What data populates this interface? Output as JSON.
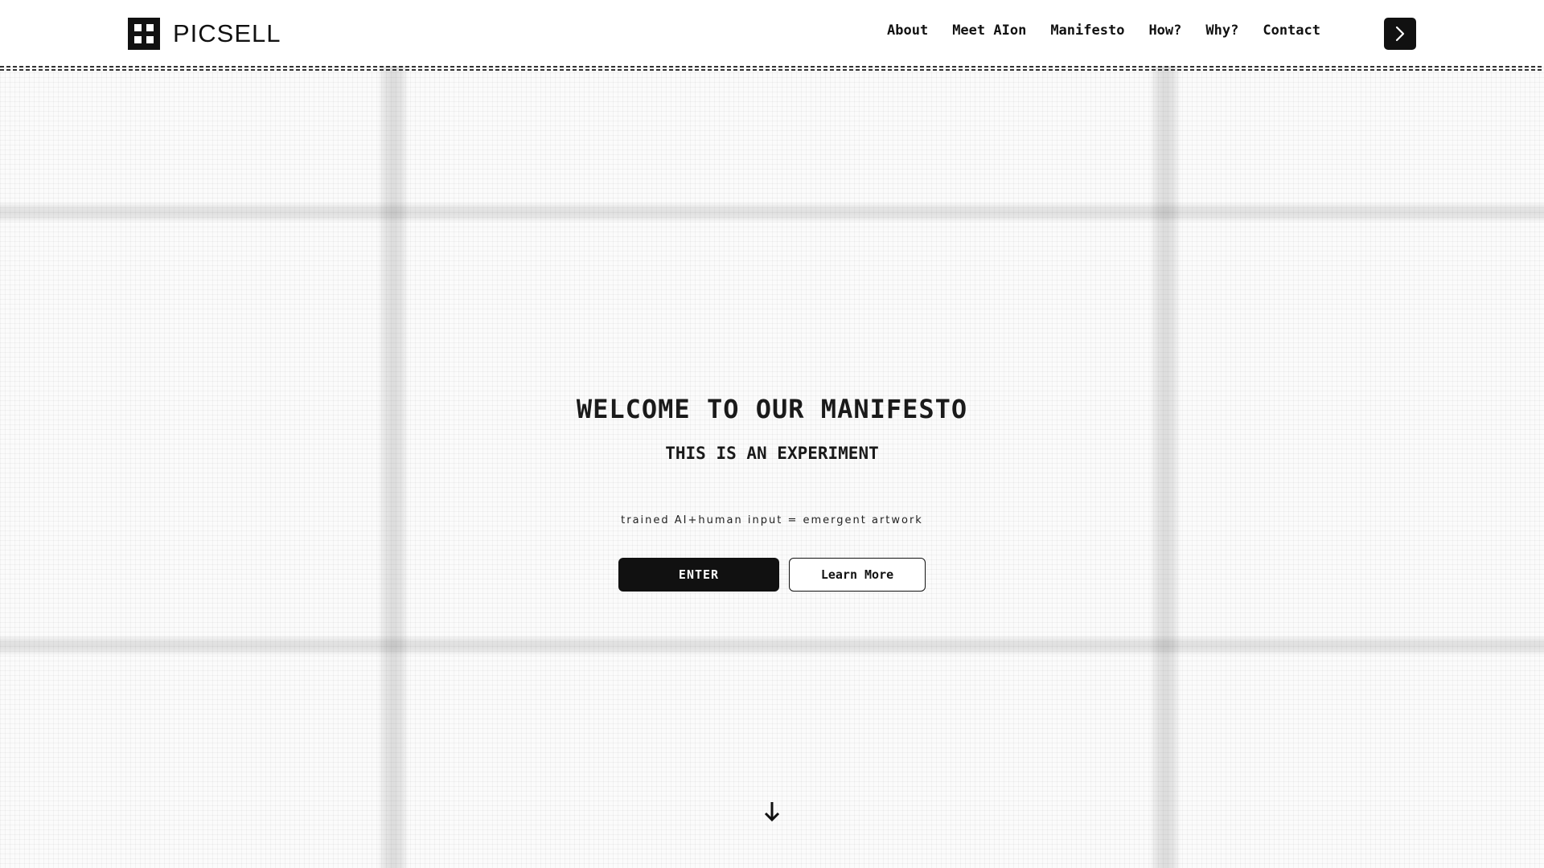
{
  "header": {
    "logo_text": "PICSELL",
    "nav": {
      "about": "About",
      "meet": "Meet AIon",
      "manifesto": "Manifesto",
      "how": "How?",
      "why": "Why?",
      "contact": "Contact"
    },
    "next_icon": "chevron-right-icon"
  },
  "hero": {
    "title": "WELCOME TO OUR MANIFESTO",
    "subtitle": "THIS IS AN EXPERIMENT",
    "tagline": "trained AI+human input = emergent artwork",
    "enter_label": "ENTER",
    "learn_more_label": "Learn More",
    "scroll_icon": "arrow-down-icon"
  },
  "colors": {
    "primary": "#111111",
    "background": "#ffffff"
  }
}
